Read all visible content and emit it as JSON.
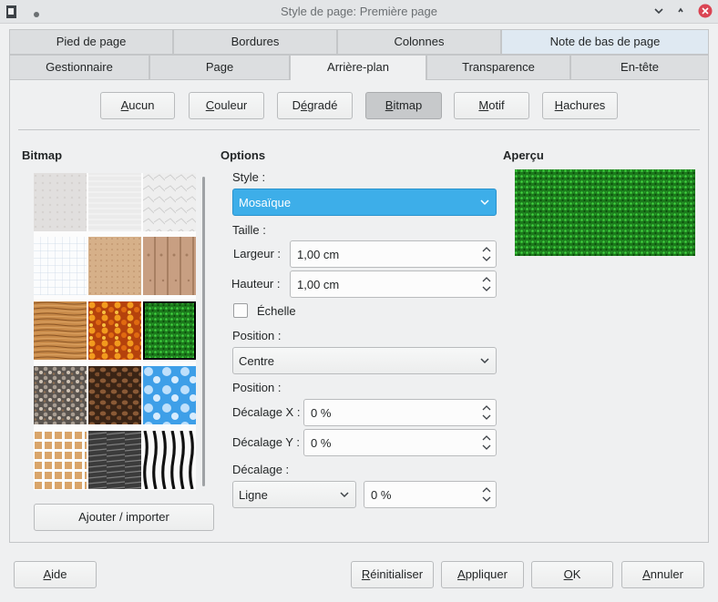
{
  "window": {
    "title": "Style de page: Première page"
  },
  "tabs_row1": [
    "Pied de page",
    "Bordures",
    "Colonnes",
    "Note de bas de page"
  ],
  "tabs_row2": [
    "Gestionnaire",
    "Page",
    "Arrière-plan",
    "Transparence",
    "En-tête"
  ],
  "fill_buttons": {
    "none": {
      "u": "A",
      "rest": "ucun"
    },
    "color": {
      "u": "C",
      "rest": "ouleur"
    },
    "gradient": {
      "pre": "D",
      "u": "é",
      "rest": "gradé"
    },
    "bitmap": {
      "u": "B",
      "rest": "itmap"
    },
    "pattern": {
      "u": "M",
      "rest": "otif"
    },
    "hatch": {
      "u": "H",
      "rest": "achures"
    }
  },
  "bitmap_section": {
    "title": "Bitmap",
    "add_button": "Ajouter / importer"
  },
  "options": {
    "title": "Options",
    "style_label": "Style :",
    "style_value": "Mosaïque",
    "size_label": "Taille :",
    "width_label": "Largeur :",
    "width_value": "1,00 cm",
    "height_label": "Hauteur :",
    "height_value": "1,00 cm",
    "scale_label": "Échelle",
    "position_label": "Position :",
    "position_value": "Centre",
    "position_label2": "Position :",
    "offset_x_label": "Décalage X :",
    "offset_x_value": "0 %",
    "offset_y_label": "Décalage Y :",
    "offset_y_value": "0 %",
    "offset_label": "Décalage :",
    "offset_mode": "Ligne",
    "offset_value": "0 %"
  },
  "preview": {
    "title": "Aperçu"
  },
  "footer": {
    "help": {
      "u": "A",
      "rest": "ide"
    },
    "reset": {
      "u": "R",
      "rest": "éinitialiser"
    },
    "apply": {
      "u": "A",
      "rest": "ppliquer"
    },
    "ok": {
      "u": "O",
      "rest": "K"
    },
    "cancel": {
      "u": "A",
      "rest": "nnuler"
    }
  },
  "colors": {
    "accent": "#3daee9",
    "tab_highlight": "#dfe9f2",
    "preview_green": "#1f8a1f"
  },
  "icons": [
    "app-icon",
    "pin-icon",
    "minimize-icon",
    "maximize-icon",
    "close-icon",
    "chevron-down-icon",
    "spin-updown-icon",
    "checkbox-icon"
  ]
}
